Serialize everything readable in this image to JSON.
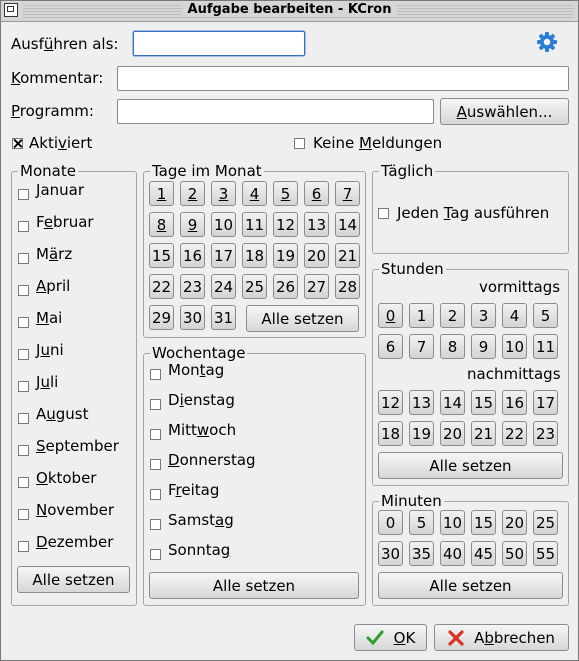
{
  "window": {
    "title": "Aufgabe bearbeiten - KCron"
  },
  "form": {
    "run_as": {
      "pre": "Ausf",
      "key": "ü",
      "post": "hren als:",
      "value": ""
    },
    "comment": {
      "pre": "",
      "key": "K",
      "post": "ommentar:",
      "value": ""
    },
    "program": {
      "pre": "",
      "key": "P",
      "post": "rogramm:",
      "value": ""
    },
    "select_button": {
      "pre": "",
      "key": "A",
      "post": "uswählen..."
    },
    "enabled": {
      "pre": "Akti",
      "key": "v",
      "post": "iert",
      "checked": true
    },
    "silent": {
      "pre": "Keine ",
      "key": "M",
      "post": "eldungen",
      "checked": false
    }
  },
  "months": {
    "title": "Monate",
    "items": [
      {
        "pre": "",
        "key": "J",
        "post": "anuar"
      },
      {
        "pre": "F",
        "key": "e",
        "post": "bruar"
      },
      {
        "pre": "M",
        "key": "ä",
        "post": "rz"
      },
      {
        "pre": "",
        "key": "A",
        "post": "pril"
      },
      {
        "pre": "",
        "key": "M",
        "post": "ai"
      },
      {
        "pre": "J",
        "key": "u",
        "post": "ni"
      },
      {
        "pre": "J",
        "key": "u",
        "post": "li"
      },
      {
        "pre": "A",
        "key": "u",
        "post": "gust"
      },
      {
        "pre": "",
        "key": "S",
        "post": "eptember"
      },
      {
        "pre": "",
        "key": "O",
        "post": "ktober"
      },
      {
        "pre": "",
        "key": "N",
        "post": "ovember"
      },
      {
        "pre": "",
        "key": "D",
        "post": "ezember"
      }
    ],
    "set_all": "Alle setzen"
  },
  "days_of_month": {
    "title": "Tage im Monat",
    "days": [
      "1",
      "2",
      "3",
      "4",
      "5",
      "6",
      "7",
      "8",
      "9",
      "10",
      "11",
      "12",
      "13",
      "14",
      "15",
      "16",
      "17",
      "18",
      "19",
      "20",
      "21",
      "22",
      "23",
      "24",
      "25",
      "26",
      "27",
      "28",
      "29",
      "30",
      "31"
    ],
    "set_all": "Alle setzen"
  },
  "weekdays": {
    "title": "Wochentage",
    "items": [
      {
        "pre": "Mon",
        "key": "t",
        "post": "ag"
      },
      {
        "pre": "D",
        "key": "i",
        "post": "enstag"
      },
      {
        "pre": "Mitt",
        "key": "w",
        "post": "och"
      },
      {
        "pre": "",
        "key": "D",
        "post": "onnerstag"
      },
      {
        "pre": "F",
        "key": "r",
        "post": "eitag"
      },
      {
        "pre": "Samst",
        "key": "a",
        "post": "g"
      },
      {
        "pre": "Sonnta",
        "key": "g",
        "post": ""
      }
    ],
    "set_all": "Alle setzen"
  },
  "daily": {
    "title": "Täglich",
    "every_day": {
      "pre": "Jeden ",
      "key": "T",
      "post": "ag ausführen"
    }
  },
  "hours": {
    "title": "Stunden",
    "am_label": "vormittags",
    "pm_label": "nachmittags",
    "am": [
      "0",
      "1",
      "2",
      "3",
      "4",
      "5",
      "6",
      "7",
      "8",
      "9",
      "10",
      "11"
    ],
    "pm": [
      "12",
      "13",
      "14",
      "15",
      "16",
      "17",
      "18",
      "19",
      "20",
      "21",
      "22",
      "23"
    ],
    "set_all": "Alle setzen"
  },
  "minutes": {
    "title": "Minuten",
    "values": [
      "0",
      "5",
      "10",
      "15",
      "20",
      "25",
      "30",
      "35",
      "40",
      "45",
      "50",
      "55"
    ],
    "set_all": "Alle setzen"
  },
  "footer": {
    "ok": {
      "pre": "",
      "key": "O",
      "post": "K"
    },
    "cancel": {
      "pre": "A",
      "key": "b",
      "post": "brechen"
    }
  },
  "colors": {
    "ok_check": "#2e9e2e",
    "cancel_x": "#d9302a",
    "gear": "#2a7fd4"
  }
}
